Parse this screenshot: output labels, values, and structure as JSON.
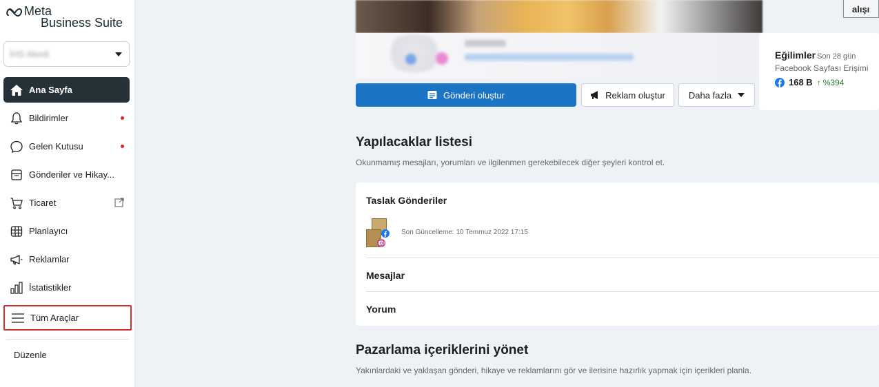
{
  "brand": {
    "line1": "Meta",
    "line2": "Business Suite"
  },
  "account": {
    "name": "İHS Akedi"
  },
  "sidebar": {
    "items": [
      {
        "label": "Ana Sayfa",
        "icon": "home-icon"
      },
      {
        "label": "Bildirimler",
        "icon": "bell-icon"
      },
      {
        "label": "Gelen Kutusu",
        "icon": "chat-icon"
      },
      {
        "label": "Gönderiler ve Hikay...",
        "icon": "posts-icon"
      },
      {
        "label": "Ticaret",
        "icon": "cart-icon"
      },
      {
        "label": "Planlayıcı",
        "icon": "calendar-grid-icon"
      },
      {
        "label": "Reklamlar",
        "icon": "megaphone-icon"
      },
      {
        "label": "İstatistikler",
        "icon": "bar-chart-icon"
      },
      {
        "label": "Tüm Araçlar",
        "icon": "menu-icon"
      }
    ],
    "edit_label": "Düzenle"
  },
  "actions": {
    "create_post": "Gönderi oluştur",
    "create_ad": "Reklam oluştur",
    "more": "Daha fazla"
  },
  "top_right_button": "alışı",
  "trends": {
    "title": "Eğilimler",
    "period": "Son 28 gün",
    "subtitle": "Facebook Sayfası Erişimi",
    "value": "168 B",
    "arrow": "↑",
    "change": "%394"
  },
  "todo": {
    "title": "Yapılacaklar listesi",
    "subtitle": "Okunmamış mesajları, yorumları ve ilgilenmen gerekebilecek diğer şeyleri kontrol et.",
    "drafts_title": "Taslak Gönderiler",
    "drafts_meta": "Son Güncelleme: 10 Temmuz 2022 17:15",
    "messages_title": "Mesajlar",
    "comments_title": "Yorum"
  },
  "marketing": {
    "title": "Pazarlama içeriklerini yönet",
    "subtitle": "Yakınlardaki ve yaklaşan gönderi, hikaye ve reklamlarını gör ve ilerisine hazırlık yapmak için içerikleri planla."
  },
  "colors": {
    "primary": "#1b74c4",
    "active_nav": "#263238",
    "highlight_border": "#d32f2f",
    "notification_dot": "#e02424",
    "trend_up": "#2e7d32"
  }
}
